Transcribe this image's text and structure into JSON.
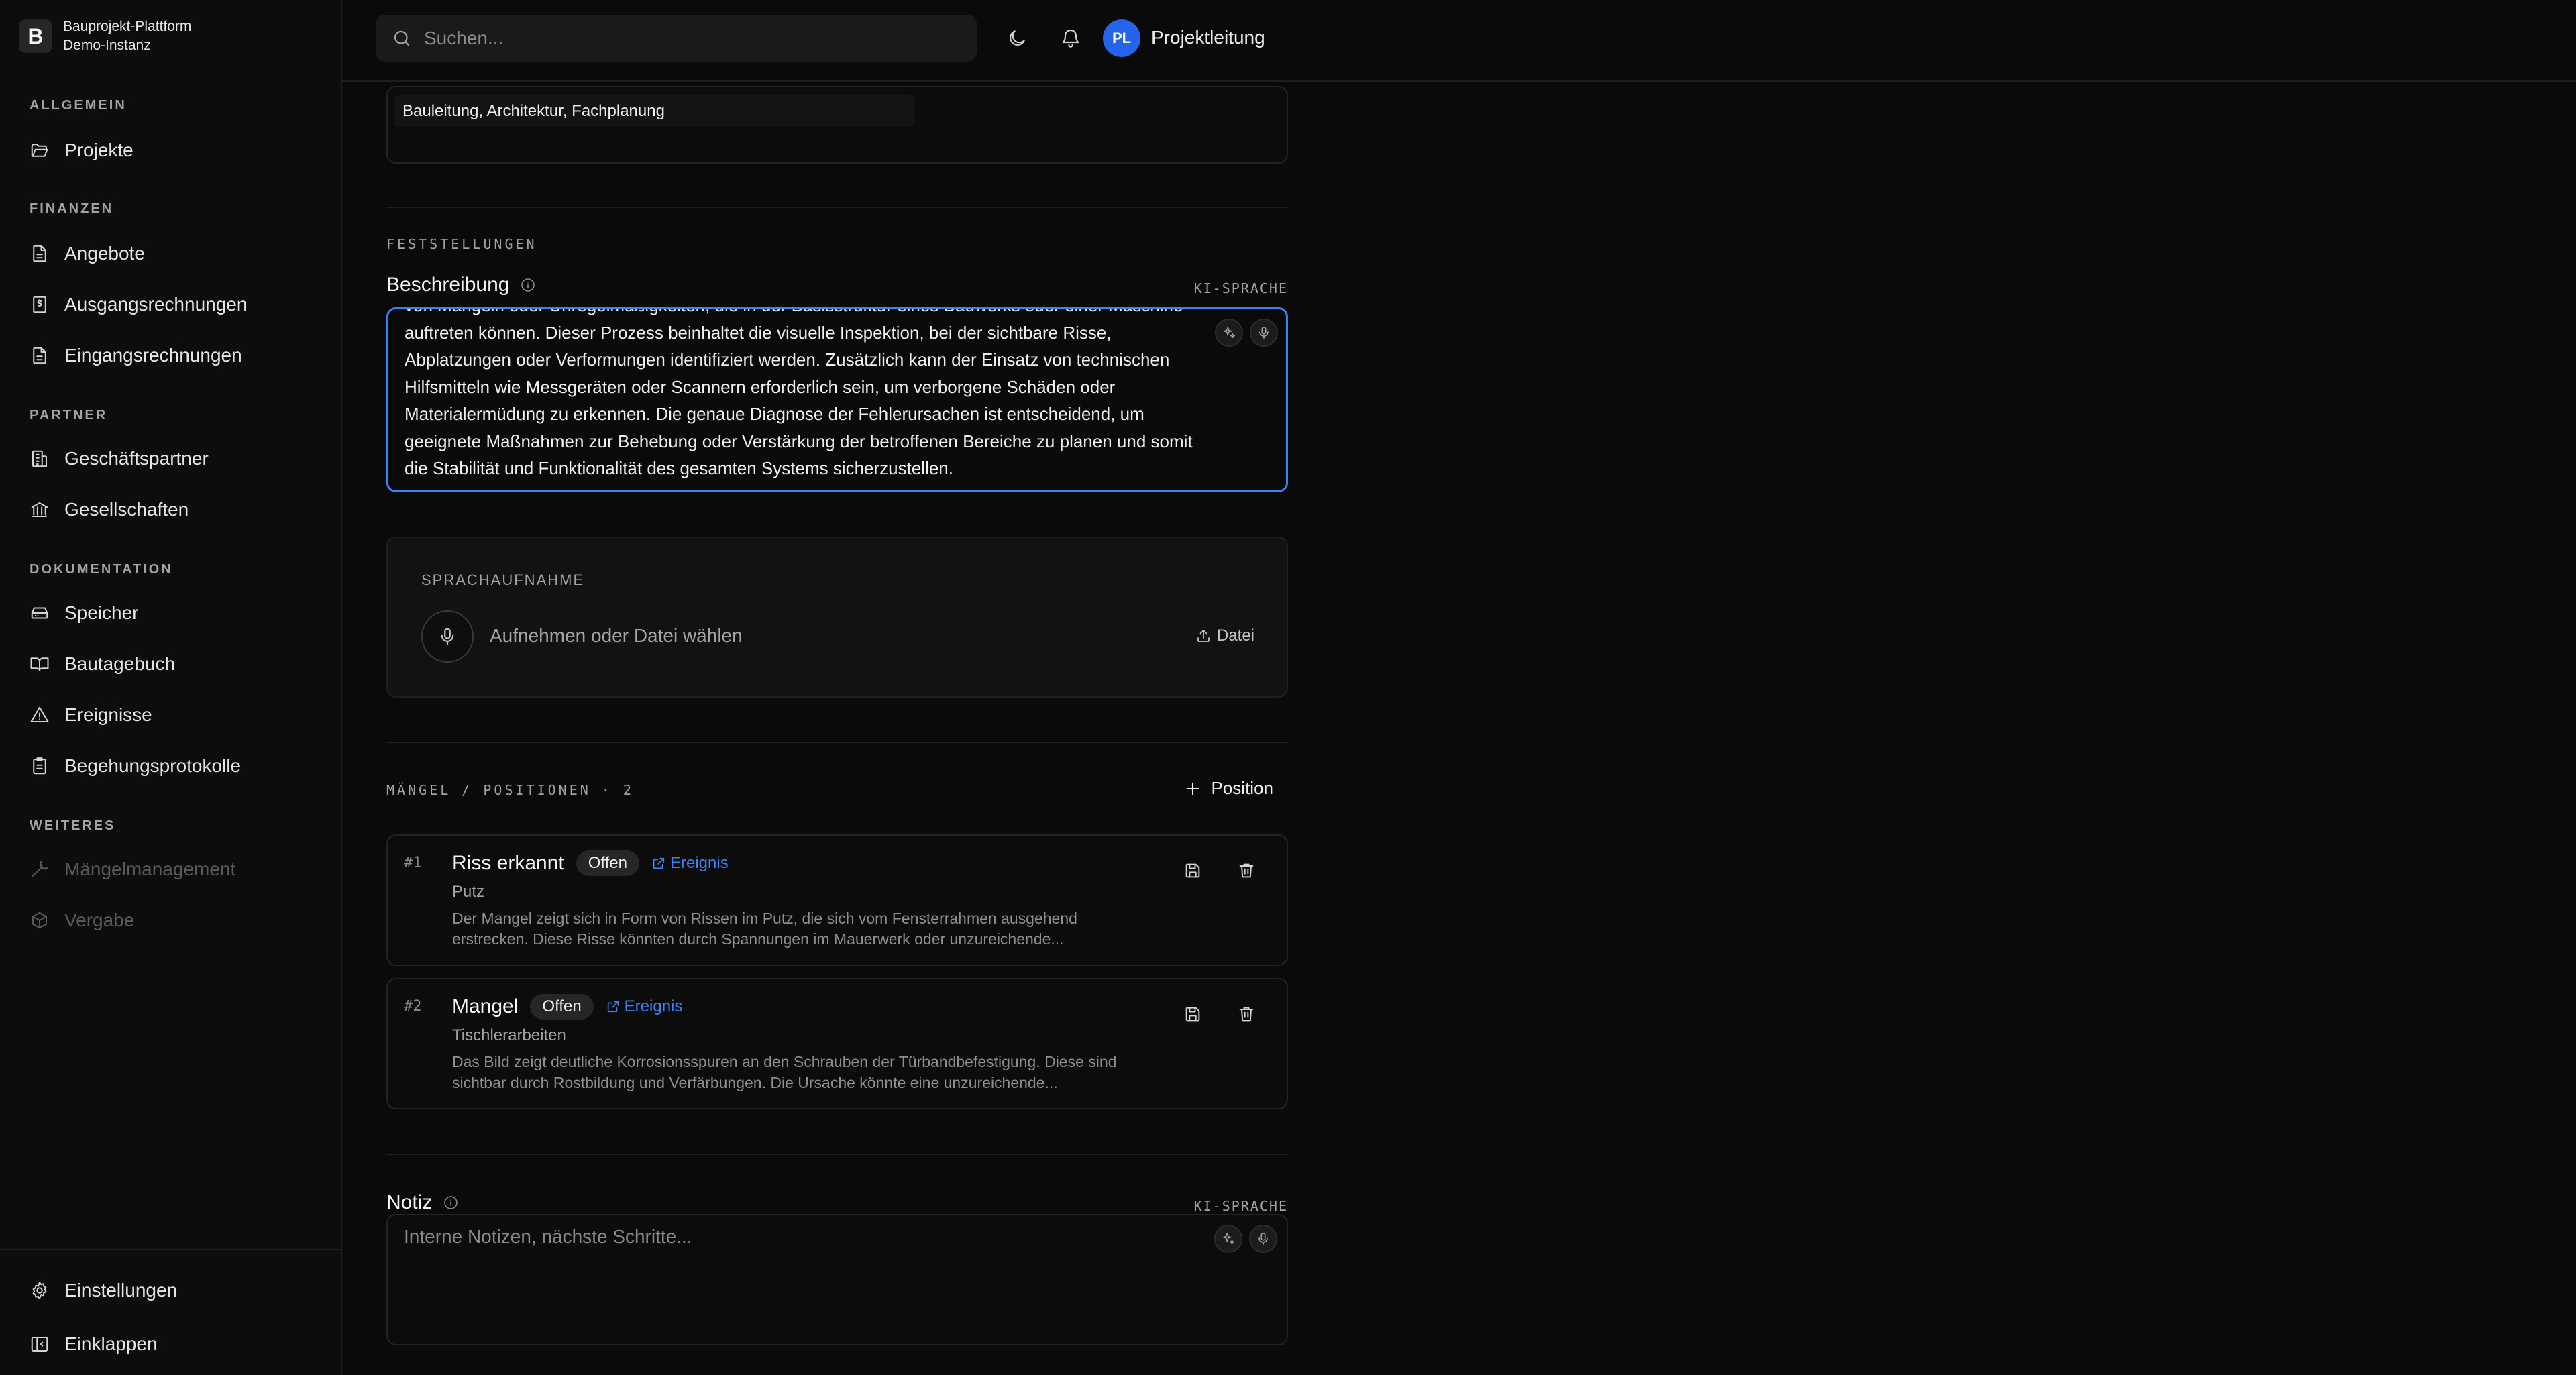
{
  "brand": {
    "logo_letter": "B",
    "name": "Bauprojekt-Plattform",
    "instance": "Demo-Instanz"
  },
  "sidebar": {
    "sections": {
      "allgemein": "ALLGEMEIN",
      "finanzen": "FINANZEN",
      "partner": "PARTNER",
      "dokumentation": "DOKUMENTATION",
      "weiteres": "WEITERES"
    },
    "items": {
      "projekte": "Projekte",
      "angebote": "Angebote",
      "ausgangsrechnungen": "Ausgangsrechnungen",
      "eingangsrechnungen": "Eingangsrechnungen",
      "geschaeftspartner": "Geschäftspartner",
      "gesellschaften": "Gesellschaften",
      "speicher": "Speicher",
      "bautagebuch": "Bautagebuch",
      "ereignisse": "Ereignisse",
      "begehungsprotokolle": "Begehungsprotokolle",
      "maengelmanagement": "Mängelmanagement",
      "vergabe": "Vergabe"
    },
    "footer": {
      "settings": "Einstellungen",
      "collapse": "Einklappen"
    }
  },
  "topbar": {
    "search_placeholder": "Suchen...",
    "avatar_initials": "PL",
    "user_name": "Projektleitung"
  },
  "main": {
    "participants_value": "Bauleitung, Architektur, Fachplanung",
    "findings_heading": "FESTSTELLUNGEN",
    "description": {
      "label": "Beschreibung",
      "ai_language": "KI-SPRACHE",
      "text": "von Mängeln oder Unregelmäßigkeiten, die in der Basisstruktur eines Bauwerks oder einer Maschine auftreten können. Dieser Prozess beinhaltet die visuelle Inspektion, bei der sichtbare Risse, Abplatzungen oder Verformungen identifiziert werden. Zusätzlich kann der Einsatz von technischen Hilfsmitteln wie Messgeräten oder Scannern erforderlich sein, um verborgene Schäden oder Materialermüdung zu erkennen. Die genaue Diagnose der Fehlerursachen ist entscheidend, um geeignete Maßnahmen zur Behebung oder Verstärkung der betroffenen Bereiche zu planen und somit die Stabilität und Funktionalität des gesamten Systems sicherzustellen."
    },
    "voice": {
      "heading": "SPRACHAUFNAHME",
      "prompt": "Aufnehmen oder Datei wählen",
      "file_label": "Datei"
    },
    "positions": {
      "heading": "MÄNGEL / POSITIONEN · 2",
      "add_label": "Position",
      "items": [
        {
          "num": "#1",
          "title": "Riss erkannt",
          "status": "Offen",
          "link": "Ereignis",
          "trade": "Putz",
          "desc": "Der Mangel zeigt sich in Form von Rissen im Putz, die sich vom Fensterrahmen ausgehend erstrecken. Diese Risse könnten durch Spannungen im Mauerwerk oder unzureichende..."
        },
        {
          "num": "#2",
          "title": "Mangel",
          "status": "Offen",
          "link": "Ereignis",
          "trade": "Tischlerarbeiten",
          "desc": "Das Bild zeigt deutliche Korrosionsspuren an den Schrauben der Türbandbefestigung. Diese sind sichtbar durch Rostbildung und Verfärbungen. Die Ursache könnte eine unzureichende..."
        }
      ]
    },
    "note": {
      "label": "Notiz",
      "ai_language": "KI-SPRACHE",
      "placeholder": "Interne Notizen, nächste Schritte..."
    }
  },
  "colors": {
    "accent": "#3b82f6",
    "avatar": "#2563eb",
    "background": "#0a0a0a"
  }
}
